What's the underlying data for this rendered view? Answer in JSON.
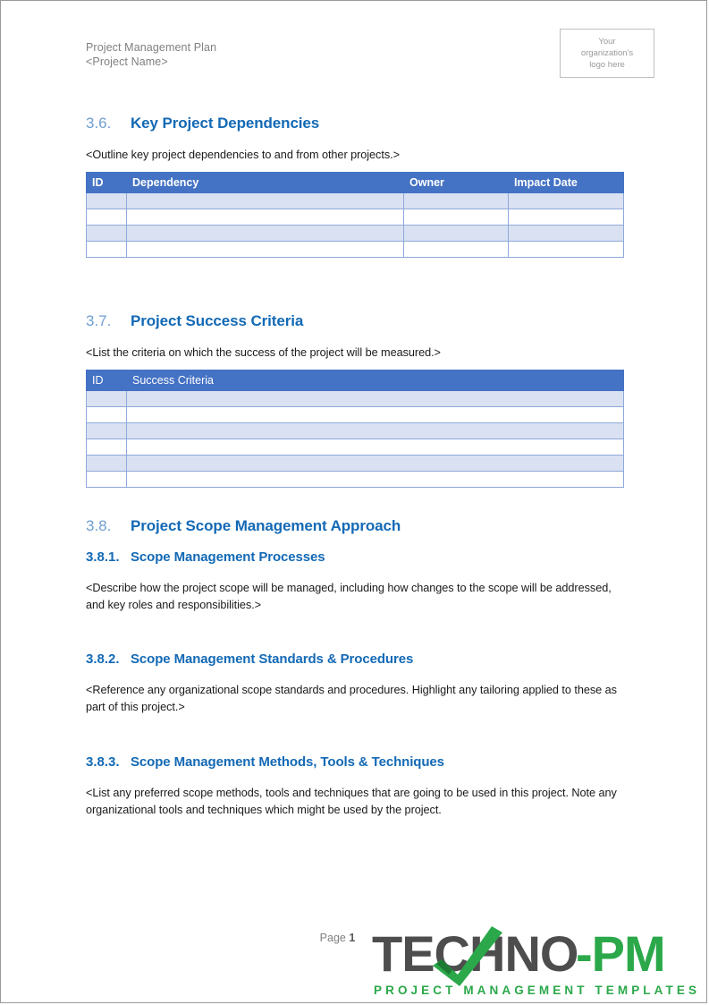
{
  "header": {
    "doc_title": "Project Management Plan",
    "project_name": "<Project Name>",
    "logo_placeholder_line1": "Your",
    "logo_placeholder_line2": "organization's",
    "logo_placeholder_line3": "logo here"
  },
  "sections": {
    "s36": {
      "number": "3.6.",
      "title": "Key Project Dependencies",
      "intro": "<Outline key project dependencies to and from other projects.>"
    },
    "s37": {
      "number": "3.7.",
      "title": "Project Success Criteria",
      "intro": "<List the criteria on which the success of the project will be measured.>"
    },
    "s38": {
      "number": "3.8.",
      "title": "Project Scope Management Approach"
    },
    "s381": {
      "number": "3.8.1.",
      "title": "Scope Management Processes",
      "body": "<Describe how the project scope will be managed, including how changes to the scope will be addressed, and key roles and responsibilities.>"
    },
    "s382": {
      "number": "3.8.2.",
      "title": "Scope Management Standards & Procedures",
      "body": "<Reference any organizational scope standards and procedures. Highlight any tailoring applied to these as part of this project.>"
    },
    "s383": {
      "number": "3.8.3.",
      "title": "Scope Management Methods, Tools & Techniques",
      "body": "<List any preferred scope methods, tools and techniques that are going to be used in this project. Note any organizational tools and techniques which might be used by the project."
    }
  },
  "tables": {
    "dependencies": {
      "columns": [
        "ID",
        "Dependency",
        "Owner",
        "Impact Date"
      ],
      "rows": [
        [
          "",
          "",
          "",
          ""
        ],
        [
          "",
          "",
          "",
          ""
        ],
        [
          "",
          "",
          "",
          ""
        ],
        [
          "",
          "",
          "",
          ""
        ]
      ]
    },
    "success_criteria": {
      "columns": [
        "ID",
        "Success Criteria"
      ],
      "rows": [
        [
          "",
          ""
        ],
        [
          "",
          ""
        ],
        [
          "",
          ""
        ],
        [
          "",
          ""
        ],
        [
          "",
          ""
        ],
        [
          "",
          ""
        ]
      ]
    }
  },
  "footer": {
    "page_label": "Page",
    "page_number": "1"
  },
  "brand": {
    "name_dark": "TECHNO",
    "name_accent": "-PM",
    "tagline": "PROJECT MANAGEMENT TEMPLATES",
    "color_dark": "#4d4d4d",
    "color_accent": "#2ba84a"
  },
  "colors": {
    "heading_blue": "#1369b5",
    "heading_number_blue": "#6f9fd0",
    "table_header_blue": "#4472c4",
    "table_shade_blue": "#d9e1f2",
    "table_border_blue": "#8ea9db",
    "header_gray": "#808080"
  }
}
